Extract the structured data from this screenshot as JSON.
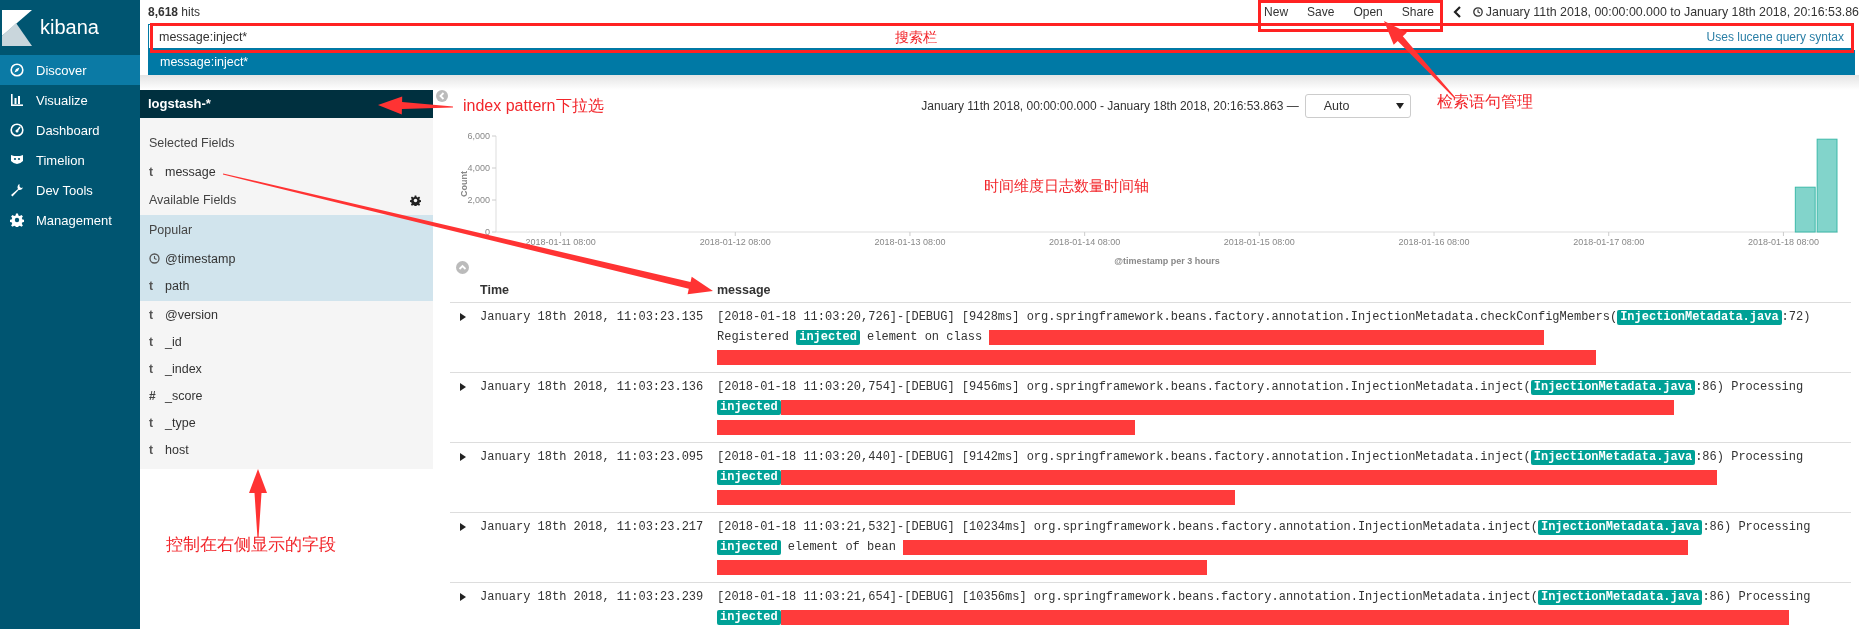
{
  "sidebar": {
    "logo": "kibana",
    "items": [
      {
        "label": "Discover",
        "selected": true,
        "kind": "compass"
      },
      {
        "label": "Visualize",
        "selected": false,
        "kind": "bars"
      },
      {
        "label": "Dashboard",
        "selected": false,
        "kind": "gauge"
      },
      {
        "label": "Timelion",
        "selected": false,
        "kind": "mask"
      },
      {
        "label": "Dev Tools",
        "selected": false,
        "kind": "wrench"
      },
      {
        "label": "Management",
        "selected": false,
        "kind": "gear"
      }
    ]
  },
  "topbar": {
    "hits": "**8,618** hits",
    "menu": [
      "New",
      "Save",
      "Open",
      "Share"
    ],
    "time_range": "January 11th 2018, 00:00:00.000 to January 18th 2018, 20:16:53.86"
  },
  "query": {
    "value": "message:inject*",
    "syntax_link": "Uses lucene query syntax",
    "suggestions": [
      "message:inject*"
    ]
  },
  "fields": {
    "index_pattern": "logstash-*",
    "selected_title": "Selected Fields",
    "selected": [
      {
        "kind": "string",
        "symbol": "t",
        "name": "message"
      }
    ],
    "available_title": "Available Fields",
    "popular_title": "Popular",
    "popular": [
      {
        "kind": "date",
        "name": "@timestamp"
      },
      {
        "kind": "string",
        "symbol": "t",
        "name": "path"
      }
    ],
    "others": [
      {
        "kind": "string",
        "symbol": "t",
        "name": "@version"
      },
      {
        "kind": "string",
        "symbol": "t",
        "name": "_id"
      },
      {
        "kind": "string",
        "symbol": "t",
        "name": "_index"
      },
      {
        "kind": "number",
        "symbol": "#",
        "name": "_score"
      },
      {
        "kind": "string",
        "symbol": "t",
        "name": "_type"
      },
      {
        "kind": "string",
        "symbol": "t",
        "name": "host"
      }
    ]
  },
  "discover": {
    "date_range": "January 11th 2018, 00:00:00.000 - January 18th 2018, 20:16:53.863 —",
    "interval": "Auto",
    "chart_data": {
      "type": "bar",
      "xlabel": "@timestamp per 3 hours",
      "ylabel": "Count",
      "categories": [
        null,
        null,
        "2018-01-11 08:00",
        null,
        null,
        null,
        null,
        null,
        null,
        null,
        "2018-01-12 08:00",
        null,
        null,
        null,
        null,
        null,
        null,
        null,
        "2018-01-13 08:00",
        null,
        null,
        null,
        null,
        null,
        null,
        null,
        "2018-01-14 08:00",
        null,
        null,
        null,
        null,
        null,
        null,
        null,
        "2018-01-15 08:00",
        null,
        null,
        null,
        null,
        null,
        null,
        null,
        "2018-01-16 08:00",
        null,
        null,
        null,
        null,
        null,
        null,
        null,
        "2018-01-17 08:00",
        null,
        null,
        null,
        null,
        null,
        null,
        null,
        "2018-01-18 08:00",
        null,
        null
      ],
      "series": [
        {
          "color": "#82d4cb",
          "values": [
            0,
            0,
            0,
            0,
            0,
            0,
            0,
            0,
            0,
            0,
            0,
            0,
            0,
            0,
            0,
            0,
            0,
            0,
            0,
            0,
            0,
            0,
            0,
            0,
            0,
            0,
            0,
            0,
            0,
            0,
            0,
            0,
            0,
            0,
            0,
            0,
            0,
            0,
            0,
            0,
            0,
            0,
            0,
            0,
            0,
            0,
            0,
            0,
            0,
            0,
            0,
            0,
            0,
            0,
            0,
            0,
            0,
            0,
            0,
            2800,
            5800
          ]
        }
      ],
      "ylim": [
        0,
        6000
      ],
      "yticks": [
        {
          "value": 0,
          "label": "0"
        },
        {
          "value": 2000,
          "label": "2,000"
        },
        {
          "value": 4000,
          "label": "4,000"
        },
        {
          "value": 6000,
          "label": "6,000"
        }
      ]
    },
    "table": {
      "columns": [
        "Time",
        "message"
      ],
      "rows": [
        {
          "time": "January 18th 2018, 11:03:23.135",
          "message": [
            [
              {
                "kind": "text",
                "text": "[2018-01-18 11:03:20,726]-[DEBUG] [9428ms] org.springframework.beans.factory.annotation.InjectionMetadata.checkConfigMembers("
              },
              {
                "kind": "highlight",
                "text": "InjectionMetadata.java"
              },
              {
                "kind": "text",
                "text": ":72)"
              }
            ],
            [
              {
                "kind": "text",
                "text": "Registered "
              },
              {
                "kind": "highlight",
                "text": "injected"
              },
              {
                "kind": "text",
                "text": " element on class "
              },
              {
                "kind": "redacted"
              }
            ],
            [
              {
                "kind": "redacted"
              }
            ]
          ]
        },
        {
          "time": "January 18th 2018, 11:03:23.136",
          "message": [
            [
              {
                "kind": "text",
                "text": "[2018-01-18 11:03:20,754]-[DEBUG] [9456ms] org.springframework.beans.factory.annotation.InjectionMetadata.inject("
              },
              {
                "kind": "highlight",
                "text": "InjectionMetadata.java"
              },
              {
                "kind": "text",
                "text": ":86) Processing"
              }
            ],
            [
              {
                "kind": "highlight",
                "text": "injected"
              },
              {
                "kind": "redacted"
              }
            ],
            [
              {
                "kind": "redacted"
              }
            ]
          ]
        },
        {
          "time": "January 18th 2018, 11:03:23.095",
          "message": [
            [
              {
                "kind": "text",
                "text": "[2018-01-18 11:03:20,440]-[DEBUG] [9142ms] org.springframework.beans.factory.annotation.InjectionMetadata.inject("
              },
              {
                "kind": "highlight",
                "text": "InjectionMetadata.java"
              },
              {
                "kind": "text",
                "text": ":86) Processing"
              }
            ],
            [
              {
                "kind": "highlight",
                "text": "injected"
              },
              {
                "kind": "redacted"
              }
            ],
            [
              {
                "kind": "redacted"
              }
            ]
          ]
        },
        {
          "time": "January 18th 2018, 11:03:23.217",
          "message": [
            [
              {
                "kind": "text",
                "text": "[2018-01-18 11:03:21,532]-[DEBUG] [10234ms] org.springframework.beans.factory.annotation.InjectionMetadata.inject("
              },
              {
                "kind": "highlight",
                "text": "InjectionMetadata.java"
              },
              {
                "kind": "text",
                "text": ":86) Processing"
              }
            ],
            [
              {
                "kind": "highlight",
                "text": "injected"
              },
              {
                "kind": "text",
                "text": " element of bean "
              },
              {
                "kind": "redacted"
              }
            ],
            [
              {
                "kind": "redacted"
              }
            ]
          ]
        },
        {
          "time": "January 18th 2018, 11:03:23.239",
          "message": [
            [
              {
                "kind": "text",
                "text": "[2018-01-18 11:03:21,654]-[DEBUG] [10356ms] org.springframework.beans.factory.annotation.InjectionMetadata.inject("
              },
              {
                "kind": "highlight",
                "text": "InjectionMetadata.java"
              },
              {
                "kind": "text",
                "text": ":86) Processing"
              }
            ],
            [
              {
                "kind": "highlight",
                "text": "injected"
              },
              {
                "kind": "redacted"
              }
            ]
          ]
        }
      ]
    }
  },
  "annotations": [
    {
      "kind": "label",
      "text": "搜索栏"
    },
    {
      "kind": "label",
      "text": "index pattern下拉选"
    },
    {
      "kind": "label",
      "text": "检索语句管理"
    },
    {
      "kind": "label",
      "text": "时间维度日志数量时间轴"
    },
    {
      "kind": "label",
      "text": "控制在右侧显示的字段"
    }
  ]
}
